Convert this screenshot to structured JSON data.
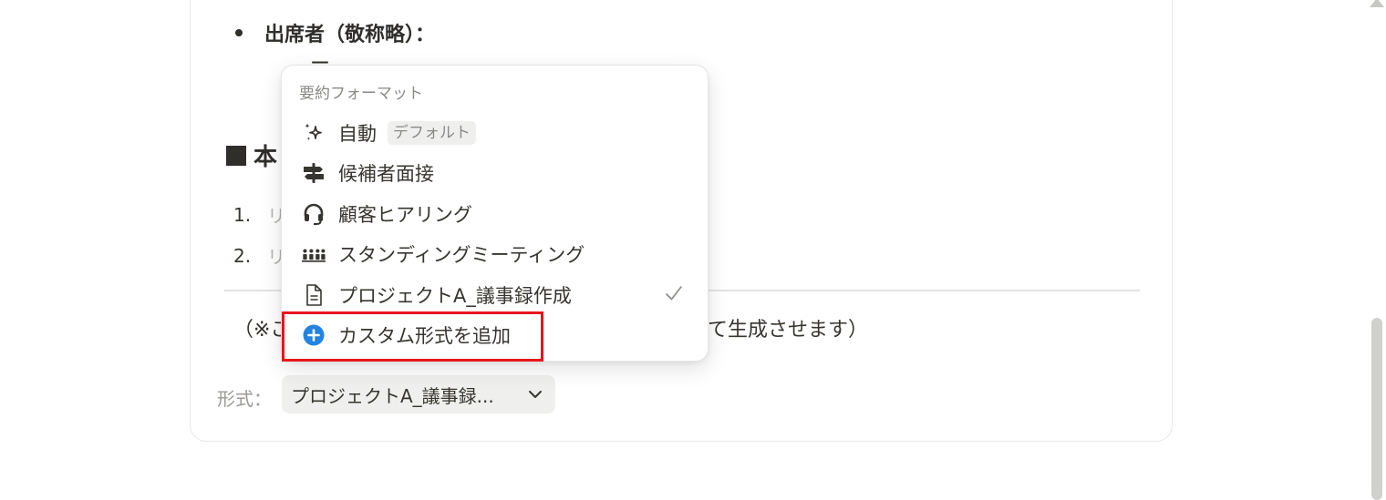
{
  "document": {
    "attendees_heading": "出席者（敬称略）：",
    "obscured_line": "ー",
    "section_title_partial": "本",
    "items": [
      {
        "number": "1.",
        "placeholder": "リ"
      },
      {
        "number": "2.",
        "placeholder": "リ"
      }
    ],
    "note_left": "（※こ",
    "note_right": "て生成させます）"
  },
  "format_selector": {
    "label": "形式：",
    "value": "プロジェクトA_議事録..."
  },
  "summary_menu": {
    "header": "要約フォーマット",
    "items": [
      {
        "label": "自動",
        "badge": "デフォルト",
        "icon": "sparkle-icon"
      },
      {
        "label": "候補者面接",
        "icon": "signpost-icon"
      },
      {
        "label": "顧客ヒアリング",
        "icon": "headset-icon"
      },
      {
        "label": "スタンディングミーティング",
        "icon": "people-group-icon"
      },
      {
        "label": "プロジェクトA_議事録作成",
        "icon": "document-icon",
        "selected": true
      },
      {
        "label": "カスタム形式を追加",
        "icon": "plus-circle-icon"
      }
    ]
  },
  "colors": {
    "accent_blue": "#2383e2",
    "highlight_red": "#e8161b",
    "text": "#37352f"
  }
}
